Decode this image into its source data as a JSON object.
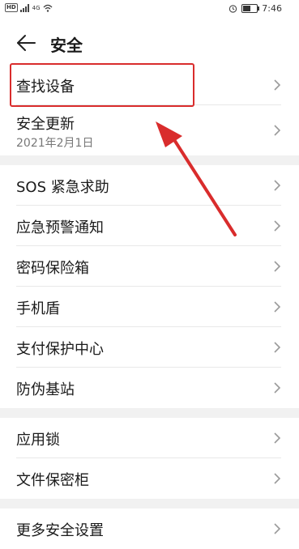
{
  "status_bar": {
    "hd_badge": "HD",
    "net_label": "4G",
    "time": "7:46",
    "battery_level": 0.5
  },
  "header": {
    "title": "安全"
  },
  "sections": [
    {
      "items": [
        {
          "label": "查找设备"
        },
        {
          "label": "安全更新",
          "sub": "2021年2月1日"
        }
      ]
    },
    {
      "items": [
        {
          "label": "SOS 紧急求助"
        },
        {
          "label": "应急预警通知"
        },
        {
          "label": "密码保险箱"
        },
        {
          "label": "手机盾"
        },
        {
          "label": "支付保护中心"
        },
        {
          "label": "防伪基站"
        }
      ]
    },
    {
      "items": [
        {
          "label": "应用锁"
        },
        {
          "label": "文件保密柜"
        }
      ]
    },
    {
      "items": [
        {
          "label": "更多安全设置"
        }
      ]
    }
  ],
  "annotation": {
    "color": "#d92c2c"
  }
}
